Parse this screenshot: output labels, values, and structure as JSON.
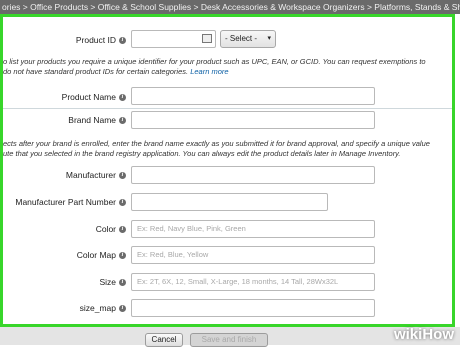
{
  "breadcrumb": "ories > Office Products > Office & School Supplies > Desk Accessories & Workspace Organizers > Platforms, Stands & Shelves > Keyboard",
  "product_id": {
    "label": "Product ID",
    "select_value": "- Select -",
    "help_line1": "o list your products you require a unique identifier for your product such as UPC, EAN, or GCID. You can request exemptions to",
    "help_line2": "do not have standard product IDs for certain categories.",
    "help_link": "Learn more"
  },
  "product_name": {
    "label": "Product Name"
  },
  "brand_name": {
    "label": "Brand Name",
    "help_line1": "ects after your brand is enrolled, enter the brand name exactly as you submitted it for brand approval, and specify a unique value",
    "help_line2": "ute that you selected in the brand registry application. You can always edit the product details later in Manage Inventory."
  },
  "manufacturer": {
    "label": "Manufacturer"
  },
  "manufacturer_part_number": {
    "label": "Manufacturer Part Number"
  },
  "color": {
    "label": "Color",
    "placeholder": "Ex: Red, Navy Blue, Pink, Green"
  },
  "color_map": {
    "label": "Color Map",
    "placeholder": "Ex: Red,  Blue, Yellow"
  },
  "size": {
    "label": "Size",
    "placeholder": "Ex: 2T, 6X, 12, Small, X-Large, 18 months, 14 Tall, 28Wx32L"
  },
  "size_map": {
    "label": "size_map"
  },
  "buttons": {
    "cancel": "Cancel",
    "save": "Save and finish"
  },
  "watermark": {
    "wiki": "wiki",
    "how": "How"
  },
  "colors": {
    "highlight": "#38d62a",
    "link": "#0b5fa5"
  }
}
